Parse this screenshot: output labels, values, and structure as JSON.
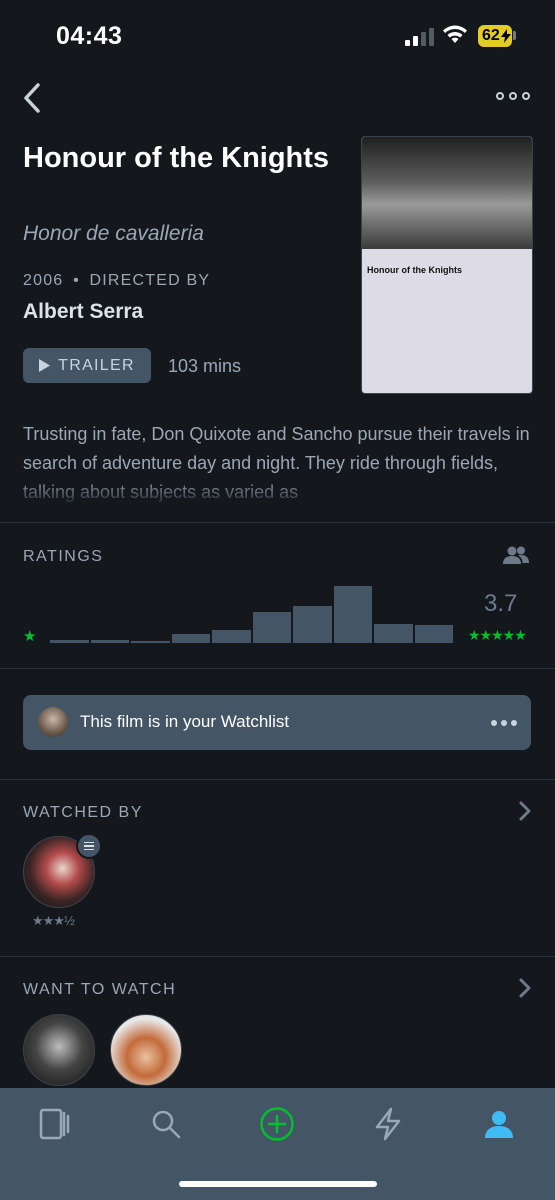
{
  "status_bar": {
    "time": "04:43",
    "battery": "62",
    "icons": [
      "signal-icon",
      "wifi-icon",
      "battery-charging-icon"
    ]
  },
  "nav": {
    "back_icon": "chevron-left-icon",
    "more_icon": "more-horizontal-icon"
  },
  "film": {
    "title": "Honour of the Knights",
    "original_title": "Honor de cavalleria",
    "year": "2006",
    "directed_by_label": "DIRECTED BY",
    "director": "Albert Serra",
    "trailer_label": "TRAILER",
    "runtime": "103 mins",
    "poster_title": "Honour of the Knights",
    "synopsis": "Trusting in fate, Don Quixote and Sancho pursue their travels in search of adventure day and night. They ride through fields, talking about subjects as varied as"
  },
  "ratings": {
    "label": "RATINGS",
    "average": "3.7",
    "histogram_levels": [
      0.05,
      0.05,
      0.03,
      0.15,
      0.22,
      0.55,
      0.65,
      1.0,
      0.33,
      0.32
    ],
    "low_star": "★",
    "high_stars": "★★★★★",
    "accent_color": "#00c030"
  },
  "watchlist": {
    "text": "This film is in your Watchlist"
  },
  "watched_by": {
    "label": "WATCHED BY",
    "friends": [
      {
        "rating": "★★★½",
        "has_review": true
      }
    ]
  },
  "want_to_watch": {
    "label": "WANT TO WATCH",
    "count_visible": 2
  },
  "tab_bar": {
    "tabs": [
      "films-icon",
      "search-icon",
      "add-icon",
      "activity-icon",
      "profile-icon"
    ],
    "active_color": "#40bcf4",
    "add_color": "#00c030"
  },
  "colors": {
    "background": "#14181c",
    "surface": "#445566",
    "muted_text": "#9aa7b6"
  }
}
